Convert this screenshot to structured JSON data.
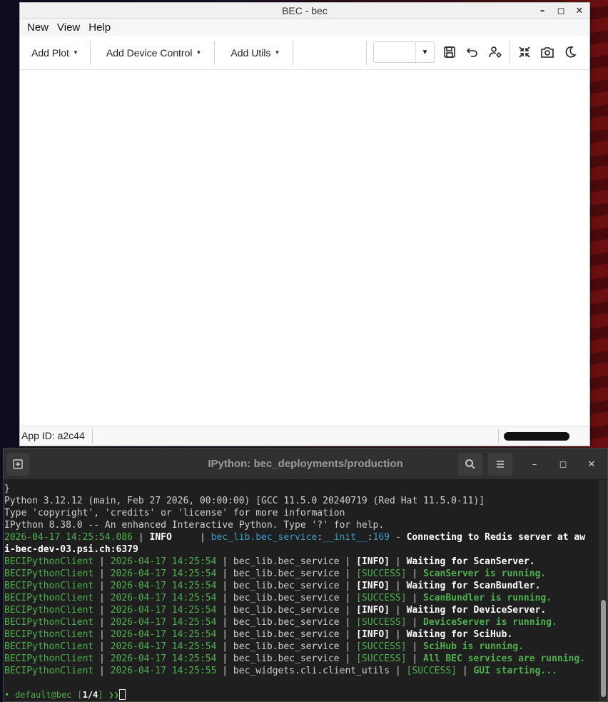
{
  "bec_window": {
    "title": "BEC - bec",
    "controls": {
      "minimize": "–",
      "maximize": "◻",
      "close": "✕"
    },
    "menu": [
      "New",
      "View",
      "Help"
    ],
    "toolbar": {
      "add_plot": "Add Plot",
      "add_device_control": "Add Device Control",
      "add_utils": "Add Utils",
      "combo_value": "",
      "icons": [
        "save-icon",
        "undo-icon",
        "user-settings-icon",
        "collapse-icon",
        "screenshot-icon",
        "dark-mode-icon"
      ]
    },
    "status": {
      "app_id": "App ID: a2c44"
    }
  },
  "terminal": {
    "title": "IPython: bec_deployments/production",
    "controls": {
      "minimize": "–",
      "maximize": "◻",
      "close": "✕"
    },
    "lines": [
      {
        "parts": [
          {
            "t": "}",
            "c": ""
          }
        ]
      },
      {
        "parts": [
          {
            "t": "Python 3.12.12 (main, Feb 27 2026, 00:00:00) [GCC 11.5.0 20240719 (Red Hat 11.5.0-11)]",
            "c": ""
          }
        ]
      },
      {
        "parts": [
          {
            "t": "Type 'copyright', 'credits' or 'license' for more information",
            "c": ""
          }
        ]
      },
      {
        "parts": [
          {
            "t": "IPython 8.38.0 -- An enhanced Interactive Python. Type '?' for help.",
            "c": ""
          }
        ]
      },
      {
        "parts": [
          {
            "t": "2026-04-17 14:25:54.086",
            "c": "g"
          },
          {
            "t": " | ",
            "c": ""
          },
          {
            "t": "INFO    ",
            "c": "w"
          },
          {
            "t": " | ",
            "c": ""
          },
          {
            "t": "bec_lib.bec_service",
            "c": "c"
          },
          {
            "t": ":",
            "c": ""
          },
          {
            "t": "__init__",
            "c": "c"
          },
          {
            "t": ":",
            "c": ""
          },
          {
            "t": "169",
            "c": "c"
          },
          {
            "t": " - ",
            "c": ""
          },
          {
            "t": "Connecting to Redis server at aw",
            "c": "w"
          }
        ]
      },
      {
        "parts": [
          {
            "t": "i-bec-dev-03.psi.ch:6379",
            "c": "w"
          }
        ]
      },
      {
        "parts": [
          {
            "t": "BECIPythonClient",
            "c": "g"
          },
          {
            "t": " | ",
            "c": ""
          },
          {
            "t": "2026-04-17 14:25:54",
            "c": "g"
          },
          {
            "t": " | bec_lib.bec_service | ",
            "c": ""
          },
          {
            "t": "[INFO]",
            "c": "w"
          },
          {
            "t": " | ",
            "c": ""
          },
          {
            "t": "Waiting for ScanServer.",
            "c": "w"
          }
        ]
      },
      {
        "parts": [
          {
            "t": "BECIPythonClient",
            "c": "g"
          },
          {
            "t": " | ",
            "c": ""
          },
          {
            "t": "2026-04-17 14:25:54",
            "c": "g"
          },
          {
            "t": " | bec_lib.bec_service | ",
            "c": ""
          },
          {
            "t": "[SUCCESS]",
            "c": "g"
          },
          {
            "t": " | ",
            "c": ""
          },
          {
            "t": "ScanServer is running.",
            "c": "gb"
          }
        ]
      },
      {
        "parts": [
          {
            "t": "BECIPythonClient",
            "c": "g"
          },
          {
            "t": " | ",
            "c": ""
          },
          {
            "t": "2026-04-17 14:25:54",
            "c": "g"
          },
          {
            "t": " | bec_lib.bec_service | ",
            "c": ""
          },
          {
            "t": "[INFO]",
            "c": "w"
          },
          {
            "t": " | ",
            "c": ""
          },
          {
            "t": "Waiting for ScanBundler.",
            "c": "w"
          }
        ]
      },
      {
        "parts": [
          {
            "t": "BECIPythonClient",
            "c": "g"
          },
          {
            "t": " | ",
            "c": ""
          },
          {
            "t": "2026-04-17 14:25:54",
            "c": "g"
          },
          {
            "t": " | bec_lib.bec_service | ",
            "c": ""
          },
          {
            "t": "[SUCCESS]",
            "c": "g"
          },
          {
            "t": " | ",
            "c": ""
          },
          {
            "t": "ScanBundler is running.",
            "c": "gb"
          }
        ]
      },
      {
        "parts": [
          {
            "t": "BECIPythonClient",
            "c": "g"
          },
          {
            "t": " | ",
            "c": ""
          },
          {
            "t": "2026-04-17 14:25:54",
            "c": "g"
          },
          {
            "t": " | bec_lib.bec_service | ",
            "c": ""
          },
          {
            "t": "[INFO]",
            "c": "w"
          },
          {
            "t": " | ",
            "c": ""
          },
          {
            "t": "Waiting for DeviceServer.",
            "c": "w"
          }
        ]
      },
      {
        "parts": [
          {
            "t": "BECIPythonClient",
            "c": "g"
          },
          {
            "t": " | ",
            "c": ""
          },
          {
            "t": "2026-04-17 14:25:54",
            "c": "g"
          },
          {
            "t": " | bec_lib.bec_service | ",
            "c": ""
          },
          {
            "t": "[SUCCESS]",
            "c": "g"
          },
          {
            "t": " | ",
            "c": ""
          },
          {
            "t": "DeviceServer is running.",
            "c": "gb"
          }
        ]
      },
      {
        "parts": [
          {
            "t": "BECIPythonClient",
            "c": "g"
          },
          {
            "t": " | ",
            "c": ""
          },
          {
            "t": "2026-04-17 14:25:54",
            "c": "g"
          },
          {
            "t": " | bec_lib.bec_service | ",
            "c": ""
          },
          {
            "t": "[INFO]",
            "c": "w"
          },
          {
            "t": " | ",
            "c": ""
          },
          {
            "t": "Waiting for SciHub.",
            "c": "w"
          }
        ]
      },
      {
        "parts": [
          {
            "t": "BECIPythonClient",
            "c": "g"
          },
          {
            "t": " | ",
            "c": ""
          },
          {
            "t": "2026-04-17 14:25:54",
            "c": "g"
          },
          {
            "t": " | bec_lib.bec_service | ",
            "c": ""
          },
          {
            "t": "[SUCCESS]",
            "c": "g"
          },
          {
            "t": " | ",
            "c": ""
          },
          {
            "t": "SciHub is running.",
            "c": "gb"
          }
        ]
      },
      {
        "parts": [
          {
            "t": "BECIPythonClient",
            "c": "g"
          },
          {
            "t": " | ",
            "c": ""
          },
          {
            "t": "2026-04-17 14:25:54",
            "c": "g"
          },
          {
            "t": " | bec_lib.bec_service | ",
            "c": ""
          },
          {
            "t": "[SUCCESS]",
            "c": "g"
          },
          {
            "t": " | ",
            "c": ""
          },
          {
            "t": "All BEC services are running.",
            "c": "gb"
          }
        ]
      },
      {
        "parts": [
          {
            "t": "BECIPythonClient",
            "c": "g"
          },
          {
            "t": " | ",
            "c": ""
          },
          {
            "t": "2026-04-17 14:25:55",
            "c": "g"
          },
          {
            "t": " | bec_widgets.cli.client_utils | ",
            "c": ""
          },
          {
            "t": "[SUCCESS]",
            "c": "g"
          },
          {
            "t": " | ",
            "c": ""
          },
          {
            "t": "GUI starting...",
            "c": "gb"
          }
        ]
      }
    ],
    "prompt": {
      "bullet": "•",
      "user": "default@bec",
      "bracket_open": "[",
      "count": "1/4",
      "bracket_close": "]",
      "arrow": "❯❯"
    }
  }
}
